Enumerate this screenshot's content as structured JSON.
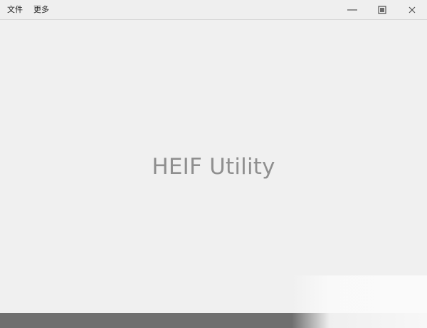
{
  "window": {
    "menu_items": [
      {
        "label": "文件"
      },
      {
        "label": "更多"
      }
    ],
    "controls": {
      "minimize_icon": "minimize-icon",
      "restore_icon": "restore-icon",
      "close_icon": "close-icon"
    }
  },
  "main": {
    "title": "HEIF Utility"
  },
  "colors": {
    "background": "#f0f0f0",
    "title_text": "#8f8f8f",
    "bottom_bar": "#6f6f6f"
  }
}
